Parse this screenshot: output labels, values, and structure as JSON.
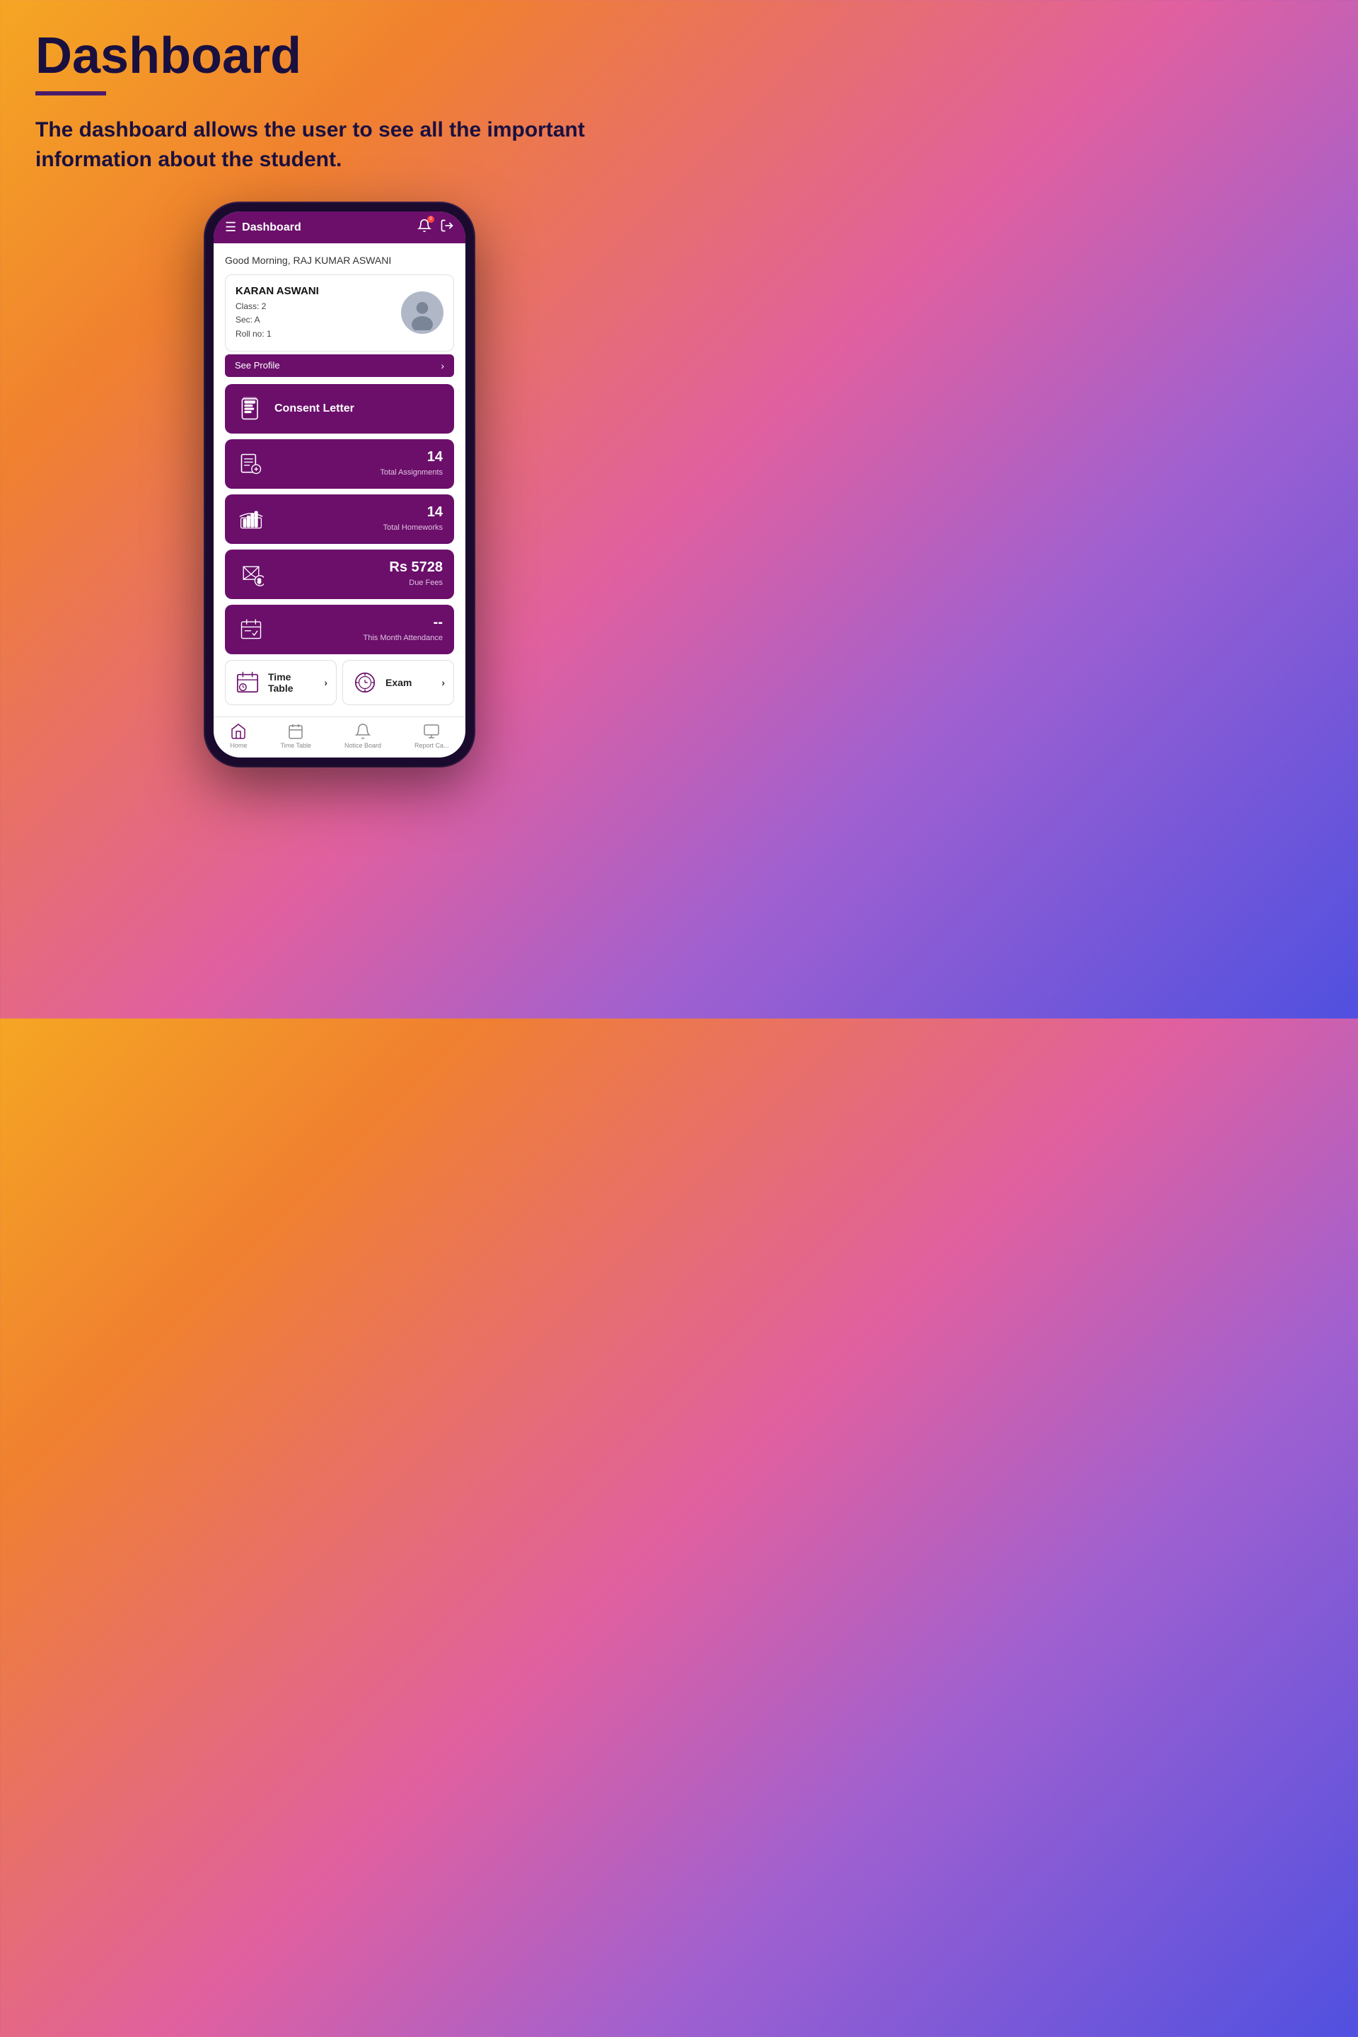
{
  "page": {
    "title": "Dashboard",
    "description": "The dashboard allows the user to see all the important information about the student."
  },
  "app": {
    "topbar": {
      "title": "Dashboard",
      "bell_label": "notifications",
      "logout_label": "logout"
    },
    "greeting": "Good Morning, RAJ KUMAR ASWANI",
    "student": {
      "name": "KARAN ASWANI",
      "class": "Class: 2",
      "section": "Sec: A",
      "roll": "Roll no: 1"
    },
    "see_profile": "See Profile",
    "menu_items": [
      {
        "id": "consent-letter",
        "label": "Consent Letter",
        "icon": "consent",
        "value": null,
        "sublabel": null
      },
      {
        "id": "assignments",
        "label": null,
        "icon": "assignment",
        "value": "14",
        "sublabel": "Total Assignments"
      },
      {
        "id": "homeworks",
        "label": null,
        "icon": "homework",
        "value": "14",
        "sublabel": "Total Homeworks"
      },
      {
        "id": "fees",
        "label": null,
        "icon": "fees",
        "value": "Rs 5728",
        "sublabel": "Due Fees"
      },
      {
        "id": "attendance",
        "label": null,
        "icon": "attendance",
        "value": "--",
        "sublabel": "This Month Attendance"
      }
    ],
    "bottom_items": [
      {
        "id": "timetable",
        "label": "Time\nTable",
        "icon": "timetable"
      },
      {
        "id": "exam",
        "label": "Exam",
        "icon": "exam"
      }
    ],
    "nav_items": [
      {
        "id": "home",
        "label": "Home",
        "active": true
      },
      {
        "id": "timetable",
        "label": "Time Table",
        "active": false
      },
      {
        "id": "noticeboard",
        "label": "Notice Board",
        "active": false
      },
      {
        "id": "reportcard",
        "label": "Report Ca...",
        "active": false
      }
    ]
  }
}
